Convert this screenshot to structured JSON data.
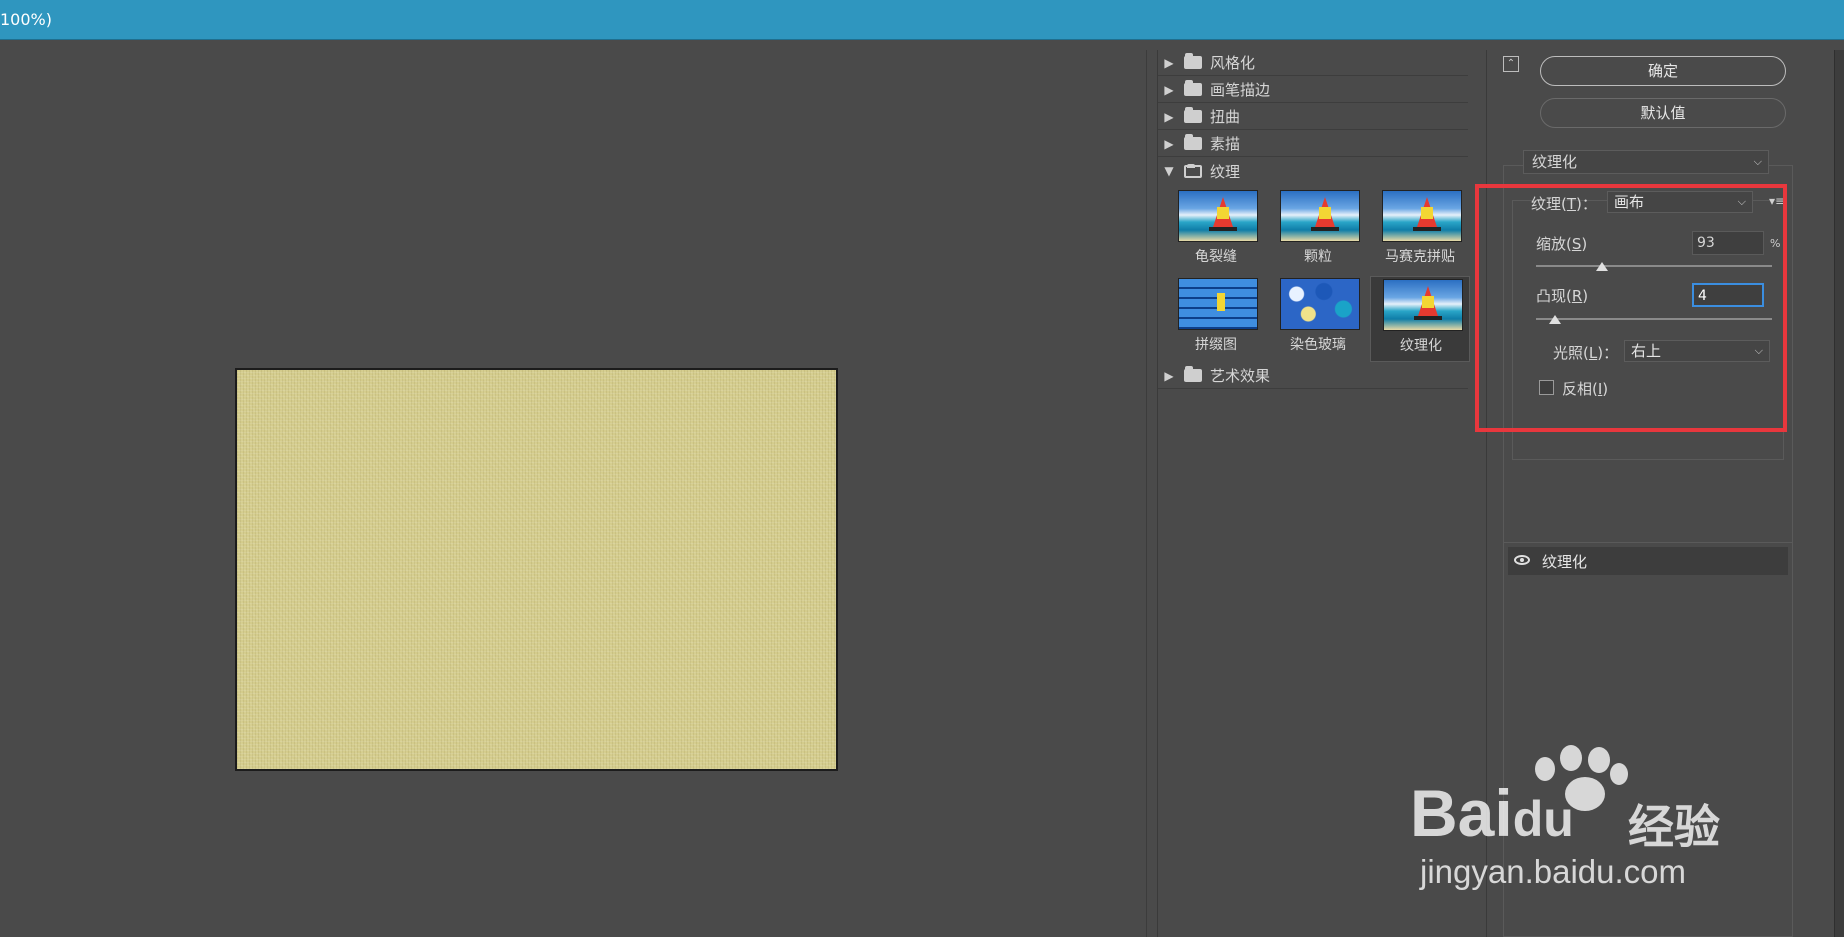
{
  "window": {
    "title": "100%)"
  },
  "gallery": {
    "folders": [
      {
        "label": "风格化",
        "expanded": false
      },
      {
        "label": "画笔描边",
        "expanded": false
      },
      {
        "label": "扭曲",
        "expanded": false
      },
      {
        "label": "素描",
        "expanded": false
      },
      {
        "label": "纹理",
        "expanded": true
      },
      {
        "label": "艺术效果",
        "expanded": false
      }
    ],
    "thumbnails": [
      {
        "label": "龟裂缝",
        "selected": false
      },
      {
        "label": "颗粒",
        "selected": false
      },
      {
        "label": "马赛克拼贴",
        "selected": false
      },
      {
        "label": "拼缀图",
        "selected": false
      },
      {
        "label": "染色玻璃",
        "selected": false
      },
      {
        "label": "纹理化",
        "selected": true
      }
    ]
  },
  "panel": {
    "ok_label": "确定",
    "default_label": "默认值",
    "filter_select": "纹理化",
    "texture_label_pre": "纹理(",
    "texture_key": "T",
    "texture_label_post": ")：",
    "texture_value": "画布",
    "scale_label_pre": "缩放(",
    "scale_key": "S",
    "scale_label_post": ")",
    "scale_value": "93",
    "scale_unit": "%",
    "scale_fraction": 0.28,
    "relief_label_pre": "凸现(",
    "relief_key": "R",
    "relief_label_post": ")",
    "relief_value": "4",
    "relief_fraction": 0.08,
    "light_label_pre": "光照(",
    "light_key": "L",
    "light_label_post": ")：",
    "light_value": "右上",
    "invert_label_pre": "反相(",
    "invert_key": "I",
    "invert_label_post": ")",
    "invert_checked": false,
    "layer_name": "纹理化"
  },
  "watermark": {
    "brand": "Bai",
    "brand2": "du",
    "cn": "经验",
    "url": "jingyan.baidu.com"
  },
  "colors": {
    "titlebar": "#2f96bf",
    "highlight_box": "#e8373d",
    "canvas_fill": "#d4cc8c"
  }
}
